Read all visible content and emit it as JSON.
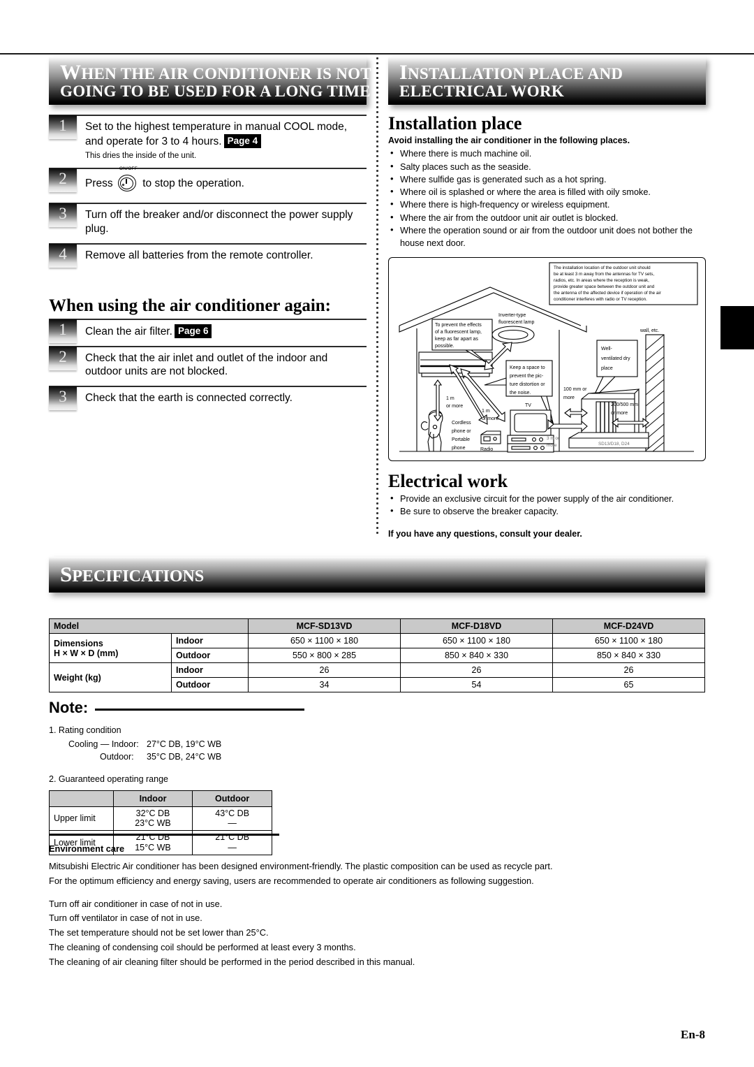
{
  "document": {
    "folio": "En-8"
  },
  "left_column": {
    "banner": {
      "line1_cap": "W",
      "line1_rest": "HEN THE AIR CONDITIONER IS NOT",
      "line2": "GOING TO BE USED FOR A LONG TIME"
    },
    "steps": [
      {
        "num": "1",
        "text": "Set to the highest temperature in manual COOL mode, and operate for 3 to 4 hours.",
        "page_ref": "Page 4",
        "sub": "This dries the inside of the unit."
      },
      {
        "num": "2",
        "text_before": "Press",
        "icon_label": "ON/OFF",
        "text_after": "to stop the operation."
      },
      {
        "num": "3",
        "text": "Turn off the breaker and/or disconnect the power supply plug."
      },
      {
        "num": "4",
        "text": "Remove all batteries from the remote controller."
      }
    ],
    "reuse_heading": "When using the air conditioner again:",
    "reuse_steps": [
      {
        "num": "1",
        "text": "Clean the air filter.",
        "page_ref": "Page 6"
      },
      {
        "num": "2",
        "text": "Check that the air inlet and outlet of the indoor and outdoor units are not blocked."
      },
      {
        "num": "3",
        "text": "Check that the earth is connected correctly."
      }
    ]
  },
  "right_column": {
    "banner": {
      "line1_cap": "I",
      "line1_rest": "NSTALLATION PLACE AND",
      "line2": "ELECTRICAL WORK"
    },
    "installation": {
      "heading": "Installation place",
      "lead": "Avoid installing the air conditioner in the following places.",
      "bullets": [
        "Where there is much machine oil.",
        "Salty places such as the seaside.",
        "Where sulfide gas is generated such as a hot spring.",
        "Where oil is splashed or where the area is filled with oily smoke.",
        "Where there is high-frequency or wireless equipment.",
        "Where the air from the outdoor unit air outlet is blocked.",
        "Where the operation sound or air from the outdoor unit does not bother the house next door."
      ]
    },
    "diagram": {
      "antenna_note": "The installation location of the outdoor unit should be at least 3 m away from the antennas for TV sets, radios, etc. In areas where the reception is weak, provide greater space between the outdoor unit and the antenna of the affected device if operation of the air conditioner interferes with radio or TV reception.",
      "antenna_note_lines": [
        "The installation location of the outdoor unit should",
        "be at least 3 m away from the antennas for TV sets,",
        "radios, etc. In areas where the reception is weak,",
        "provide greater space between the outdoor unit and",
        "the antenna of the affected device if operation of the air",
        "conditioner interferes with radio or TV reception."
      ],
      "lamp_label_lines": [
        "Inverter-type",
        "fluorescent lamp"
      ],
      "fluorescent_callout_lines": [
        "To prevent the effects",
        "of a fluorescent lamp,",
        "keep as far apart as",
        "possible."
      ],
      "tv_callout_lines": [
        "Keep a space to",
        "prevent the pic-",
        "ture distortion or",
        "the noise."
      ],
      "dry_place_callout_lines": [
        "Well-",
        "ventilated dry",
        "place"
      ],
      "labels": {
        "wall": "wall, etc.",
        "dist_100mm": [
          "100 mm or",
          "more"
        ],
        "dist_200_500mm": [
          "200/500 mm",
          "or more"
        ],
        "dist_1m_left": [
          "1 m",
          "or more"
        ],
        "dist_1m_mid": [
          "1 m",
          "or more"
        ],
        "dist_3m": [
          "3 m or",
          "more"
        ],
        "cordless": [
          "Cordless",
          "phone or",
          "Portable",
          "phone"
        ],
        "radio": "Radio",
        "tv": "TV",
        "model_stamp": "SD13/D18, D24"
      }
    },
    "electrical": {
      "heading": "Electrical work",
      "bullets": [
        "Provide an exclusive circuit for the power supply of the air conditioner.",
        "Be sure to observe the breaker capacity."
      ],
      "dealer_note": "If you have any questions, consult your dealer."
    }
  },
  "specifications": {
    "banner": {
      "cap": "S",
      "rest": "PECIFICATIONS"
    },
    "table": {
      "model_label": "Model",
      "models": [
        "MCF-SD13VD",
        "MCF-D18VD",
        "MCF-D24VD"
      ],
      "rows": [
        {
          "group": "Dimensions",
          "group_line2": "H × W × D (mm)",
          "sub": "Indoor",
          "values": [
            "650 × 1100 × 180",
            "650 × 1100 × 180",
            "650 × 1100 × 180"
          ]
        },
        {
          "sub": "Outdoor",
          "values": [
            "550 × 800 × 285",
            "850 × 840 × 330",
            "850 × 840 × 330"
          ]
        },
        {
          "group": "Weight (kg)",
          "sub": "Indoor",
          "values": [
            "26",
            "26",
            "26"
          ]
        },
        {
          "sub": "Outdoor",
          "values": [
            "34",
            "54",
            "65"
          ]
        }
      ]
    }
  },
  "note": {
    "heading": "Note:",
    "item1": {
      "number": "1.",
      "title": "Rating condition",
      "cooling_label": "Cooling — Indoor:",
      "cooling_value": "27°C DB, 19°C WB",
      "outdoor_label": "Outdoor:",
      "outdoor_value": "35°C DB, 24°C WB"
    },
    "item2": {
      "number": "2.",
      "title": "Guaranteed operating range",
      "table": {
        "headers": [
          "",
          "Indoor",
          "Outdoor"
        ],
        "rows": [
          {
            "label": "Upper limit",
            "indoor": [
              "32°C DB",
              "23°C WB"
            ],
            "outdoor": [
              "43°C DB",
              "—"
            ]
          },
          {
            "label": "Lower limit",
            "indoor": [
              "21°C DB",
              "15°C WB"
            ],
            "outdoor": [
              "21°C DB",
              "—"
            ]
          }
        ]
      }
    }
  },
  "environment": {
    "heading": "Environment care",
    "paragraphs": [
      "Mitsubishi Electric Air conditioner has been designed environment-friendly. The plastic composition can be used as recycle part.",
      "For the optimum efficiency and energy saving, users are recommended to operate air conditioners as following suggestion."
    ],
    "tips": [
      "Turn off air conditioner in case of not in use.",
      "Turn off ventilator in case of not in use.",
      "The set temperature should not be set lower than 25°C.",
      "The cleaning of condensing coil should be performed at least every 3 months.",
      "The cleaning of air cleaning filter should be performed in the period described in this manual."
    ]
  }
}
